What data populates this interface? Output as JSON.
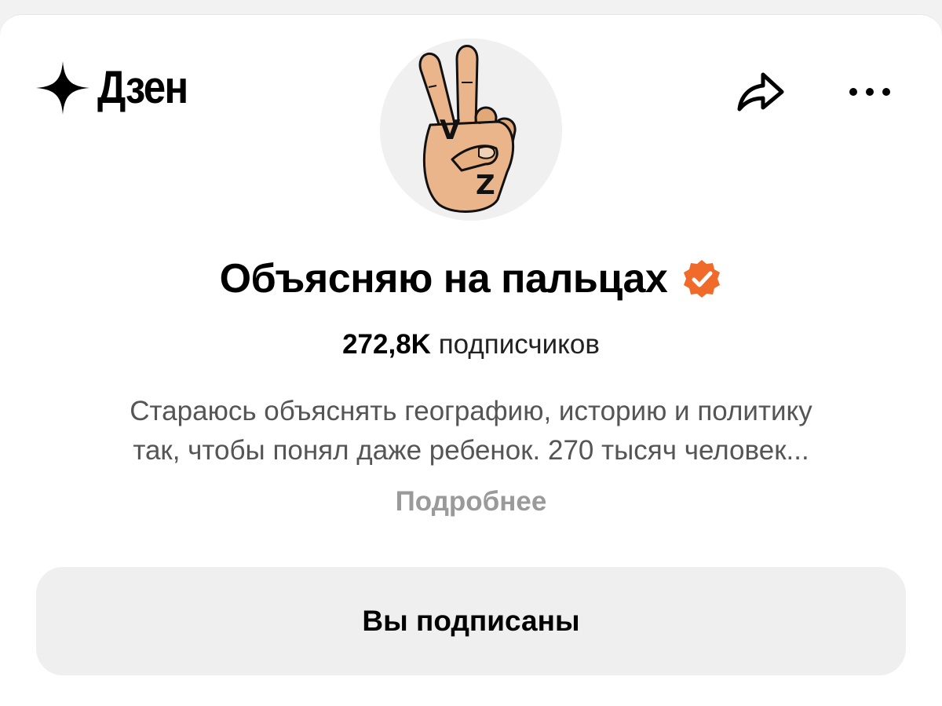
{
  "header": {
    "logo_text": "Дзен",
    "logo_icon": "dzen-star-icon",
    "share_icon": "share-icon",
    "more_icon": "more-dots-icon"
  },
  "channel": {
    "avatar_letters": {
      "top": "V",
      "bottom": "Z"
    },
    "name": "Объясняю на пальцах",
    "verified_color": "#f06a2a",
    "subscriber_count": "272,8K",
    "subscriber_label": "подписчиков",
    "description_line1": "Стараюсь объяснять географию, историю и политику",
    "description_line2": "так, чтобы понял даже ребенок. 270 тысяч человек...",
    "more_link": "Подробнее"
  },
  "actions": {
    "subscribed_label": "Вы подписаны"
  }
}
